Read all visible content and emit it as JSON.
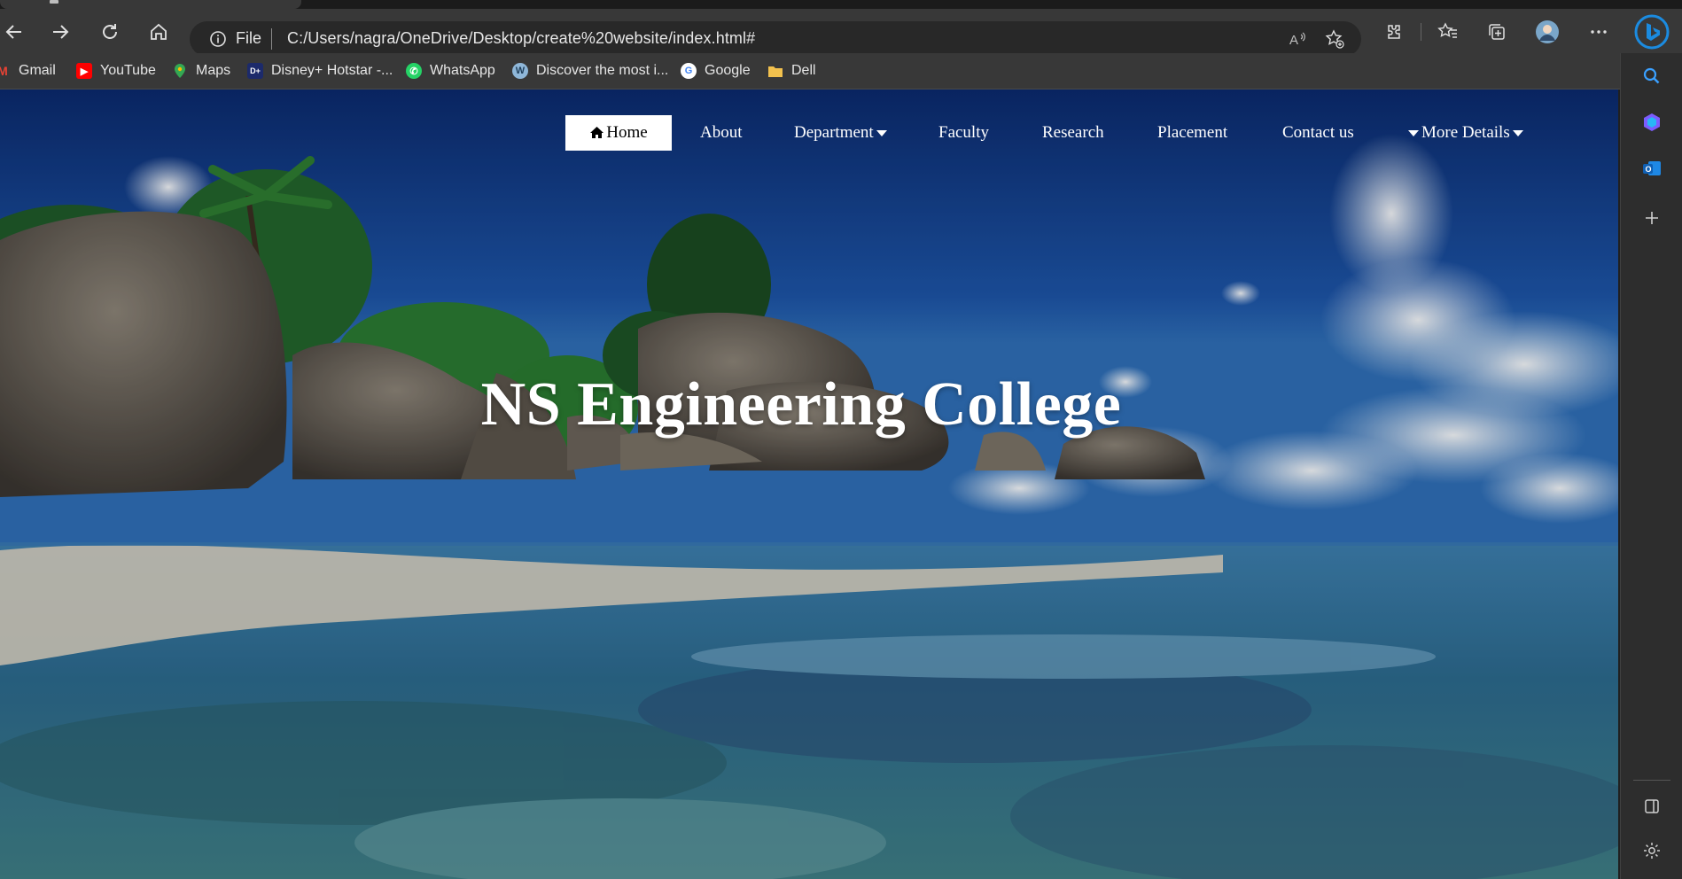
{
  "browser": {
    "address_bar": {
      "scheme_label": "File",
      "url": "C:/Users/nagra/OneDrive/Desktop/create%20website/index.html#"
    },
    "toolbar_icons": [
      "back-arrow-icon",
      "forward-arrow-icon",
      "refresh-icon",
      "home-icon"
    ],
    "bookmarks": [
      {
        "label": "Gmail",
        "icon": "gmail-icon",
        "color": "#ea4335"
      },
      {
        "label": "YouTube",
        "icon": "youtube-icon",
        "color": "#ff0000"
      },
      {
        "label": "Maps",
        "icon": "maps-icon",
        "color": "#34a853"
      },
      {
        "label": "Disney+ Hotstar -...",
        "icon": "hotstar-icon",
        "color": "#1c2a6b"
      },
      {
        "label": "WhatsApp",
        "icon": "whatsapp-icon",
        "color": "#25d366"
      },
      {
        "label": "Discover the most i...",
        "icon": "wordpress-icon",
        "color": "#8fb7d9"
      },
      {
        "label": "Google",
        "icon": "google-icon",
        "color": "#4285f4"
      },
      {
        "label": "Dell",
        "icon": "folder-icon",
        "color": "#f2c14e"
      }
    ]
  },
  "website": {
    "nav": {
      "home": "Home",
      "about": "About",
      "department": "Department",
      "faculty": "Faculty",
      "research": "Research",
      "placement": "Placement",
      "contact": "Contact us",
      "more": "More Details"
    },
    "hero_title": "NS Engineering College"
  },
  "colors": {
    "chrome_dark": "#383838",
    "sky_deep": "#0f2f73",
    "sea": "#2e6f9a",
    "nav_active_bg": "#ffffff",
    "edge_accent": "#1b8be0"
  }
}
